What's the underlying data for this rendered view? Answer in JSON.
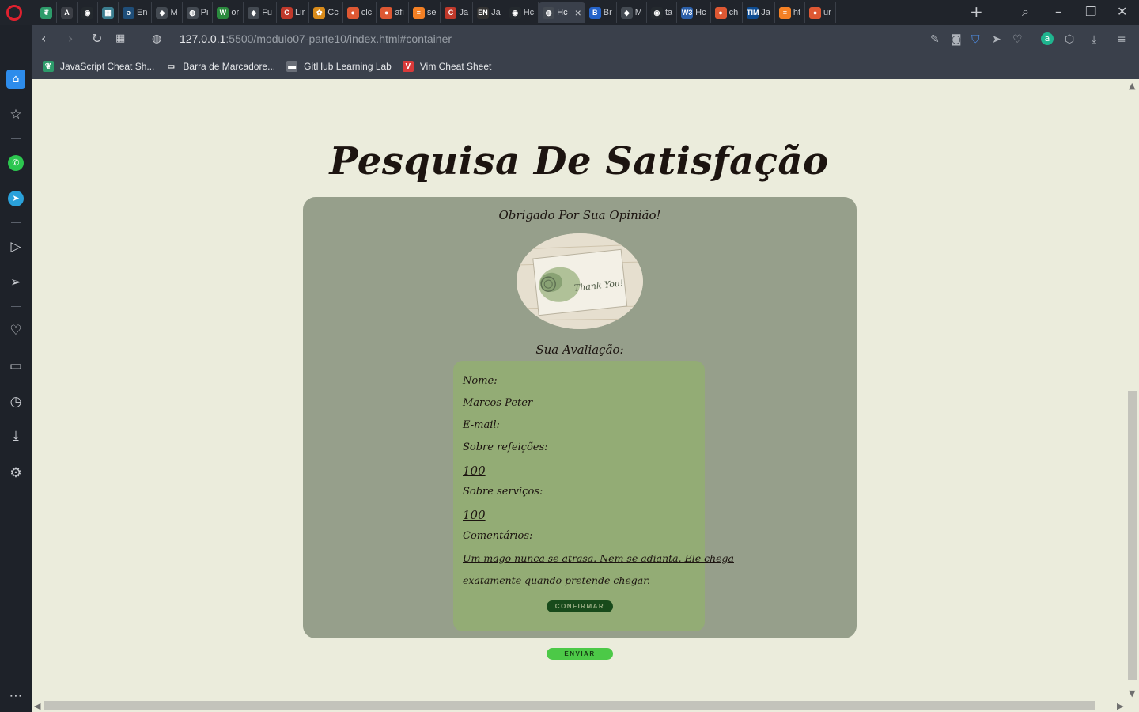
{
  "browser": {
    "tabs": [
      {
        "label": "",
        "icon": "leaf-icon",
        "color": "#2d9b6a"
      },
      {
        "label": "",
        "icon": "angular-icon",
        "color": "#3c3f46"
      },
      {
        "label": "",
        "icon": "github-icon",
        "color": "#24292e"
      },
      {
        "label": "",
        "icon": "calendar-icon",
        "color": "#3b7d8f"
      },
      {
        "label": "En",
        "icon": "dictionary-icon",
        "color": "#1f4e79"
      },
      {
        "label": "M",
        "icon": "mask-icon",
        "color": "#444a52"
      },
      {
        "label": "Pi",
        "icon": "globe-icon",
        "color": "#444a52"
      },
      {
        "label": "or",
        "icon": "wordreference-icon",
        "color": "#2b8a3e"
      },
      {
        "label": "Fu",
        "icon": "mask-icon",
        "color": "#444a52"
      },
      {
        "label": "Lir",
        "icon": "codecademy-icon",
        "color": "#c0392b"
      },
      {
        "label": "Cc",
        "icon": "colorpicker-icon",
        "color": "#d98b1a"
      },
      {
        "label": "clc",
        "icon": "duckduckgo-icon",
        "color": "#de5833"
      },
      {
        "label": "afi",
        "icon": "duckduckgo-icon",
        "color": "#de5833"
      },
      {
        "label": "se",
        "icon": "stackoverflow-icon",
        "color": "#f48024"
      },
      {
        "label": "Ja",
        "icon": "codecademy-icon",
        "color": "#c0392b"
      },
      {
        "label": "Ja",
        "icon": "en-icon",
        "color": "#333333"
      },
      {
        "label": "Hc",
        "icon": "github-icon",
        "color": "#24292e"
      },
      {
        "label": "Hc",
        "icon": "globe-icon",
        "color": "#444a52",
        "active": true
      },
      {
        "label": "Br",
        "icon": "brands-icon",
        "color": "#2563c9"
      },
      {
        "label": "M",
        "icon": "mask-icon",
        "color": "#444a52"
      },
      {
        "label": "ta",
        "icon": "github-icon",
        "color": "#24292e"
      },
      {
        "label": "Hc",
        "icon": "w3-icon",
        "color": "#2b5fa8"
      },
      {
        "label": "ch",
        "icon": "duckduckgo-icon",
        "color": "#de5833"
      },
      {
        "label": "Ja",
        "icon": "tim-icon",
        "color": "#0e4c92"
      },
      {
        "label": "ht",
        "icon": "stackoverflow-icon",
        "color": "#f48024"
      },
      {
        "label": "ur",
        "icon": "duckduckgo-icon",
        "color": "#de5833"
      }
    ],
    "url_host": "127.0.0.1",
    "url_path": ":5500/modulo07-parte10/index.html#container",
    "bookmarks": [
      {
        "label": "JavaScript Cheat Sh...",
        "icon": "leaf-icon",
        "color": "#2d9b6a"
      },
      {
        "label": "Barra de Marcadore...",
        "icon": "folder-icon",
        "color": "#3a404b"
      },
      {
        "label": "GitHub Learning Lab",
        "icon": "lab-icon",
        "color": "#6a6f78"
      },
      {
        "label": "Vim Cheat Sheet",
        "icon": "vim-icon",
        "color": "#d93a3a"
      }
    ]
  },
  "page": {
    "title": "Pesquisa De Satisfação",
    "thanks": "Obrigado Por Sua Opinião!",
    "image_caption": "Thank You!",
    "evaluation_heading": "Sua Avaliação:",
    "form": {
      "name_label": "Nome:",
      "name_value": "Marcos Peter",
      "email_label": "E-mail:",
      "meals_label": "Sobre refeições:",
      "meals_value": "100",
      "services_label": "Sobre serviços:",
      "services_value": "100",
      "comments_label": "Comentários:",
      "comments_line1": "Um mago nunca se atrasa. Nem se adianta. Ele chega",
      "comments_line2": "exatamente quando pretende chegar.",
      "confirm_label": "CONFIRMAR"
    },
    "submit_label": "ENVIAR"
  },
  "colors": {
    "page_bg": "#ebecdc",
    "card_bg": "#969f8b",
    "form_bg": "#93ac75",
    "confirm_bg": "#184a1b",
    "submit_bg": "#4cc947"
  }
}
